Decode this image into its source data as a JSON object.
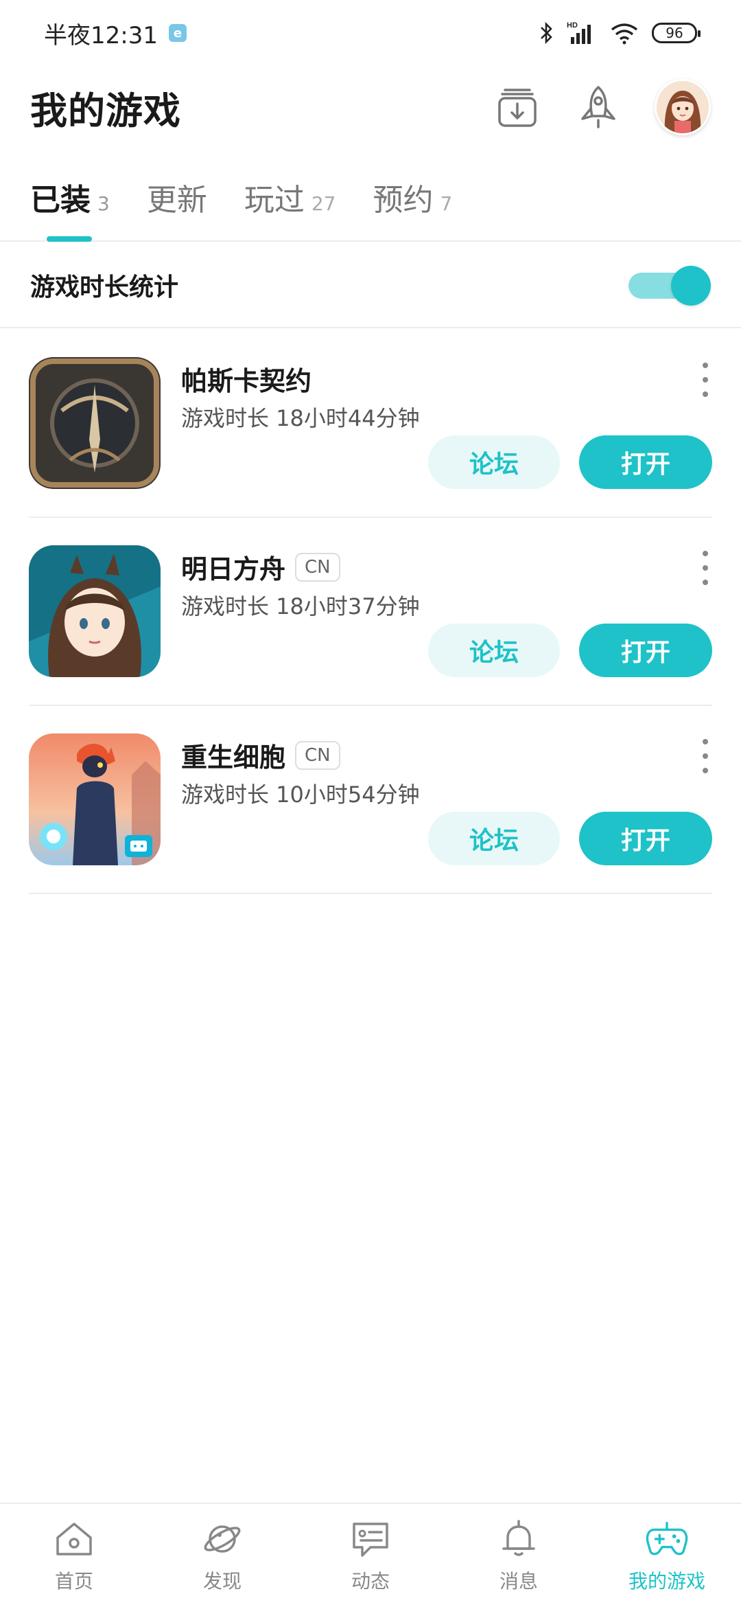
{
  "status_bar": {
    "time": "半夜12:31",
    "network": "HD",
    "battery": "96"
  },
  "header": {
    "title": "我的游戏",
    "download_icon": "download-box-icon",
    "rocket_icon": "rocket-icon"
  },
  "tabs": [
    {
      "label": "已装",
      "count": "3",
      "active": true
    },
    {
      "label": "更新",
      "count": "",
      "active": false
    },
    {
      "label": "玩过",
      "count": "27",
      "active": false
    },
    {
      "label": "预约",
      "count": "7",
      "active": false
    }
  ],
  "stats": {
    "label": "游戏时长统计",
    "enabled": true
  },
  "games": [
    {
      "name": "帕斯卡契约",
      "region": "",
      "play_time": "游戏时长 18小时44分钟",
      "forum_label": "论坛",
      "open_label": "打开"
    },
    {
      "name": "明日方舟",
      "region": "CN",
      "play_time": "游戏时长 18小时37分钟",
      "forum_label": "论坛",
      "open_label": "打开"
    },
    {
      "name": "重生细胞",
      "region": "CN",
      "play_time": "游戏时长 10小时54分钟",
      "forum_label": "论坛",
      "open_label": "打开"
    }
  ],
  "bottom_nav": [
    {
      "label": "首页",
      "icon": "home-icon",
      "active": false
    },
    {
      "label": "发现",
      "icon": "planet-icon",
      "active": false
    },
    {
      "label": "动态",
      "icon": "feed-icon",
      "active": false
    },
    {
      "label": "消息",
      "icon": "bell-icon",
      "active": false
    },
    {
      "label": "我的游戏",
      "icon": "gamepad-icon",
      "active": true
    }
  ],
  "colors": {
    "accent": "#1ec2c8",
    "accent_light": "#e8f8f8"
  }
}
